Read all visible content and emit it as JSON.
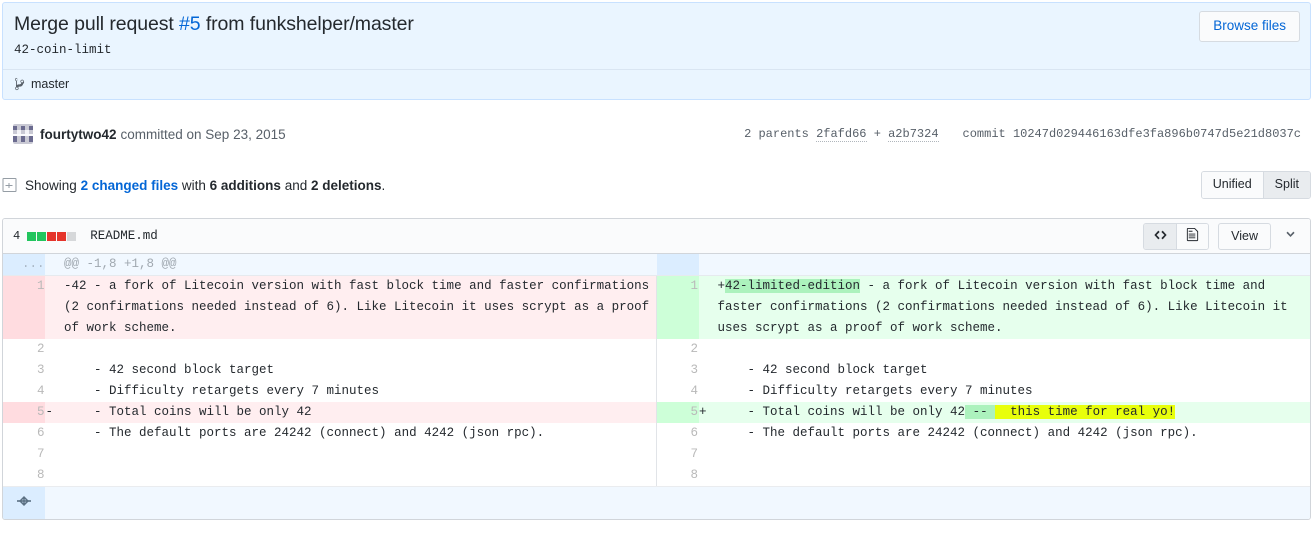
{
  "commit": {
    "title_prefix": "Merge pull request ",
    "pr_number": "#5",
    "title_suffix": " from funkshelper/master",
    "description": "42-coin-limit",
    "browse_files_label": "Browse files",
    "branch_name": "master",
    "author": "fourtytwo42",
    "committed_text": "committed on Sep 23, 2015",
    "parents_label": "2 parents",
    "parent_one": "2fafd66",
    "parents_plus": "+",
    "parent_two": "a2b7324",
    "commit_label": "commit",
    "commit_sha": "10247d029446163dfe3fa896b0747d5e21d8037c"
  },
  "summary": {
    "showing": "Showing",
    "changed_files": "2 changed files",
    "with": "with",
    "additions": "6 additions",
    "and": "and",
    "deletions": "2 deletions",
    "period": ".",
    "unified_label": "Unified",
    "split_label": "Split",
    "selected_view": "Split"
  },
  "file": {
    "stat_count": "4",
    "stat_blocks": [
      "add",
      "add",
      "del",
      "del",
      "non"
    ],
    "name": "README.md",
    "view_label": "View"
  },
  "diff": {
    "hunk_header": "@@ -1,8 +1,8 @@",
    "hunk_gutter": "...",
    "rows": [
      {
        "type": "change",
        "left_num": "1",
        "left_marker": "",
        "left_code": "-42 - a fork of Litecoin version with fast block time and faster confirmations (2 confirmations needed instead of 6). Like Litecoin it uses scrypt as a proof of work scheme.",
        "right_num": "1",
        "right_marker": "",
        "right_pre": "+",
        "right_hl": "42-limited-edition",
        "right_post": " - a fork of Litecoin version with fast block time and faster confirmations (2 confirmations needed instead of 6). Like Litecoin it uses scrypt as a proof of work scheme."
      },
      {
        "type": "context",
        "left_num": "2",
        "left_code": "",
        "right_num": "2",
        "right_code": ""
      },
      {
        "type": "context",
        "left_num": "3",
        "left_code": "    - 42 second block target",
        "right_num": "3",
        "right_code": "    - 42 second block target"
      },
      {
        "type": "context",
        "left_num": "4",
        "left_code": "    - Difficulty retargets every 7 minutes",
        "right_num": "4",
        "right_code": "    - Difficulty retargets every 7 minutes"
      },
      {
        "type": "change2",
        "left_num": "5",
        "left_marker": "-",
        "left_code": "    - Total coins will be only 42",
        "right_num": "5",
        "right_marker": "+",
        "right_pre": "    - Total coins will be only 42",
        "right_hl_green": " -- ",
        "right_hl_yellow": "  this time for real yo!"
      },
      {
        "type": "context",
        "left_num": "6",
        "left_code": "    - The default ports are 24242 (connect) and 4242 (json rpc).",
        "right_num": "6",
        "right_code": "    - The default ports are 24242 (connect) and 4242 (json rpc)."
      },
      {
        "type": "context",
        "left_num": "7",
        "left_code": "",
        "right_num": "7",
        "right_code": ""
      },
      {
        "type": "context",
        "left_num": "8",
        "left_code": "",
        "right_num": "8",
        "right_code": ""
      }
    ]
  }
}
